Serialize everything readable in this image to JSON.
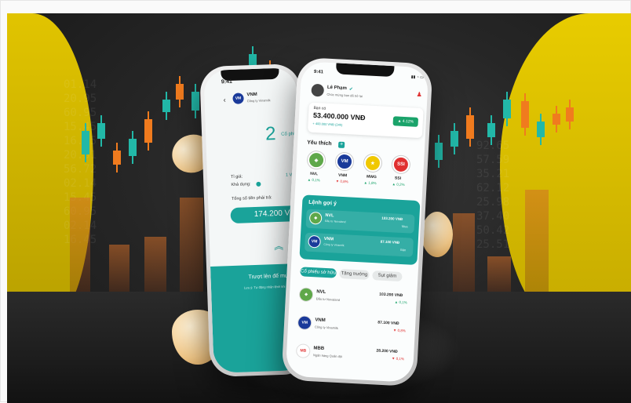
{
  "background": {
    "accent": "#e1c400",
    "candle_up": "#22b8a8",
    "candle_down": "#f07b1e",
    "numbers_left": [
      "01.14",
      "20.95",
      "60.95",
      "15.45",
      "16.45",
      "20.51",
      "56.72",
      "02.14",
      "15.45",
      "60.95",
      "02.14",
      "16.45"
    ],
    "numbers_right": [
      "92.65",
      "57.59",
      "35.21",
      "62.12",
      "25.98",
      "37.40",
      "50.42",
      "25.51"
    ]
  },
  "back_phone": {
    "time": "9:41",
    "stock_code": "VNM",
    "company": "Công ty Vinamilk",
    "quantity_value": "2",
    "quantity_unit": "Cổ phi",
    "price_label": "Tỉ giá:",
    "price_value": "1 V",
    "available_label": "Khả dụng:",
    "total_label": "Tổng số tiền phải trả:",
    "total_value": "174.200 V",
    "swipe_text": "Trượt lên để mu",
    "note_text": "Lưu ý: Tự động nhận lệnh khi"
  },
  "front_phone": {
    "time": "9:41",
    "user_name": "Lê Phạm",
    "greeting": "Chúc mừng bạn đã trở lại",
    "balance_label": "Bạn có",
    "balance_value": "53.400.000 VNĐ",
    "balance_change": "+ 400.000 VNĐ (24h)",
    "balance_pct": "4.12%",
    "favorites_title": "Yêu thích",
    "favorites": [
      {
        "code": "NVL",
        "change": "0,1%",
        "dir": "up",
        "color": "#5fa84a",
        "glyph": "◈"
      },
      {
        "code": "VNM",
        "change": "0,8%",
        "dir": "down",
        "color": "#1a3a9a",
        "glyph": "VM"
      },
      {
        "code": "MWG",
        "change": "1,8%",
        "dir": "up",
        "color": "#f0c800",
        "glyph": "★"
      },
      {
        "code": "SSI",
        "change": "0,2%",
        "dir": "up",
        "color": "#e03030",
        "glyph": "SSI"
      }
    ],
    "suggest_title": "Lệnh gợi ý",
    "suggestions": [
      {
        "code": "NVL",
        "company": "Đầu tư Novaland",
        "price": "103.200 VNĐ",
        "action": "Mua"
      },
      {
        "code": "VNM",
        "company": "Công ty Vinamilk",
        "price": "87.100 VNĐ",
        "action": "Bán"
      }
    ],
    "tabs": [
      "Cổ phiếu sở hữu",
      "Tăng trưởng",
      "Sụt giảm"
    ],
    "holdings": [
      {
        "code": "NVL",
        "company": "Đầu tư Novaland",
        "price": "103.200 VNĐ",
        "change": "0,1%",
        "dir": "up"
      },
      {
        "code": "VNM",
        "company": "Công ty Vinamilk",
        "price": "87.100 VNĐ",
        "change": "0,8%",
        "dir": "down"
      },
      {
        "code": "MBB",
        "company": "Ngân hàng Quân đội",
        "price": "28.200 VNĐ",
        "change": "0,1%",
        "dir": "down"
      }
    ]
  }
}
